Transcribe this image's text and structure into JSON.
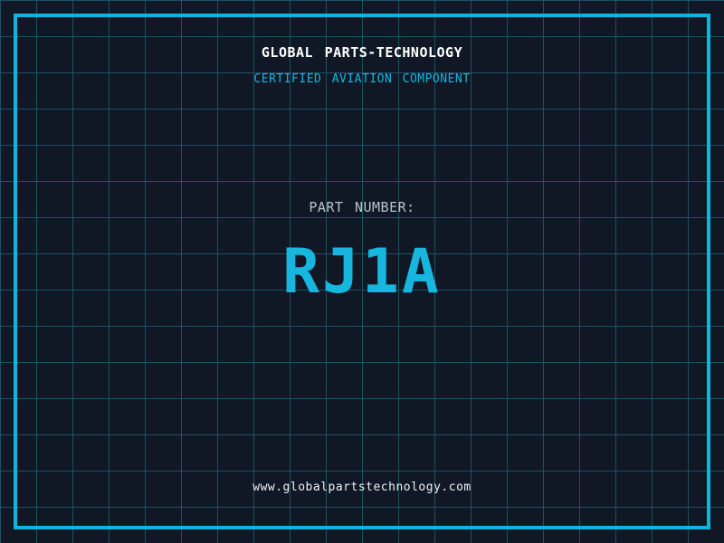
{
  "card": {
    "title": "GLOBAL PARTS-TECHNOLOGY",
    "subtitle": "CERTIFIED AVIATION COMPONENT",
    "part_number_label": "PART NUMBER:",
    "part_number": "RJ1A",
    "website": "www.globalpartstechnology.com"
  },
  "colors": {
    "background": "#101826",
    "grid_line": "#1e5064",
    "frame": "#0fb4df",
    "accent_cyan": "#17b6de",
    "title_white": "#ffffff",
    "label_gray": "#b9c2cd",
    "footer_white": "#eef1f4"
  }
}
